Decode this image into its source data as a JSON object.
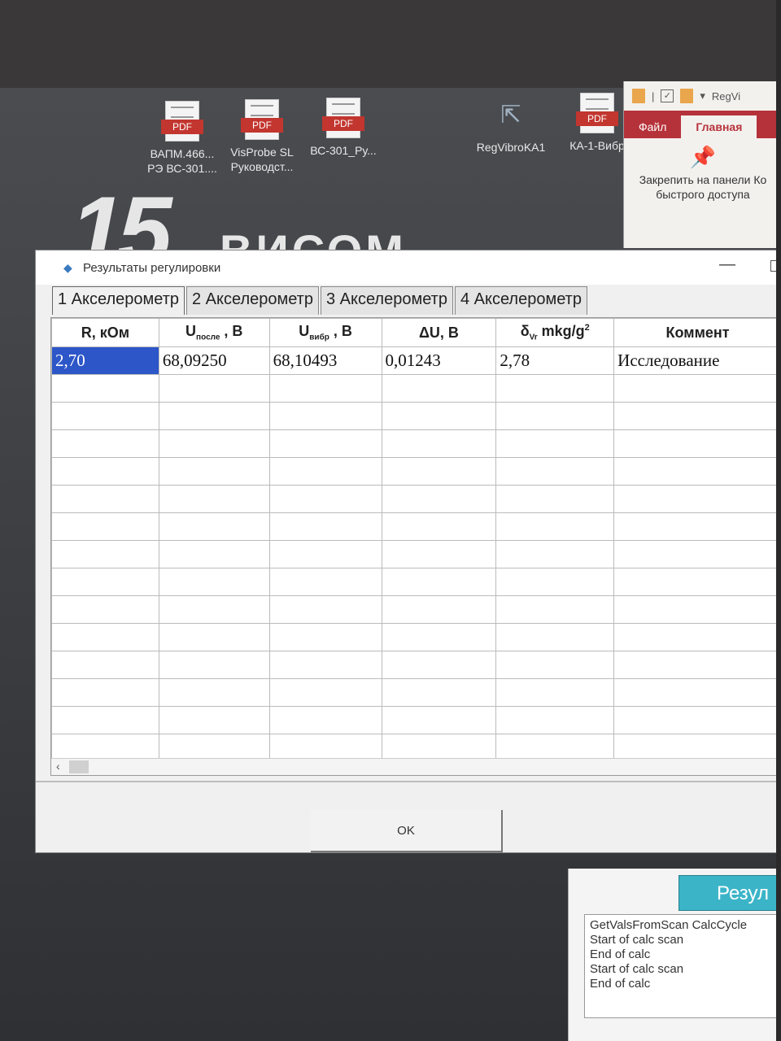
{
  "desktop": {
    "icons": [
      {
        "label1": "ВАПМ.466...",
        "label2": "РЭ ВС-301...."
      },
      {
        "label1": "VisProbe SL",
        "label2": "Руководст..."
      },
      {
        "label1": "ВС-301_Ру...",
        "label2": ""
      },
      {
        "label1": "RegVibroKA1",
        "label2": ""
      },
      {
        "label1": "КА-1-Вибр",
        "label2": ""
      }
    ],
    "pdf_tag": "PDF",
    "wallpaper_number": "15",
    "wallpaper_word": "ВИСОМ"
  },
  "ribbon": {
    "app_title": "RegVi",
    "tab_file": "Файл",
    "tab_home": "Главная",
    "pin_label_line1": "Закрепить на панели",
    "pin_label_line2": "быстрого доступа",
    "pin_label_cut": "Ко"
  },
  "background_app": {
    "results_button": "Резул",
    "log": [
      "GetValsFromScan CalcCycle",
      "Start of calc scan",
      "End of calc",
      "Start of calc scan",
      "End of calc"
    ]
  },
  "dialog": {
    "title": "Результаты регулировки",
    "tabs": [
      "1 Акселерометр",
      "2 Акселерометр",
      "3 Акселерометр",
      "4 Акселерометр"
    ],
    "active_tab": 0,
    "columns": {
      "r": {
        "main": "R",
        "tail": ", кОм"
      },
      "u_after": {
        "main": "U",
        "sub": "после",
        "tail": " , В"
      },
      "u_vibr": {
        "main": "U",
        "sub": "вибр",
        "tail": " , В"
      },
      "du": {
        "main": "ΔU, В"
      },
      "delta": {
        "main": "δ",
        "sub": "Vr",
        "tail": " mkg/g",
        "sup": "2"
      },
      "comment": {
        "main": "Коммент"
      }
    },
    "rows": [
      {
        "r": "2,70",
        "u_after": "68,09250",
        "u_vibr": "68,10493",
        "du": "0,01243",
        "delta": "2,78",
        "comment": "Исследование"
      }
    ],
    "empty_rows": 14,
    "ok_label": "OK"
  }
}
